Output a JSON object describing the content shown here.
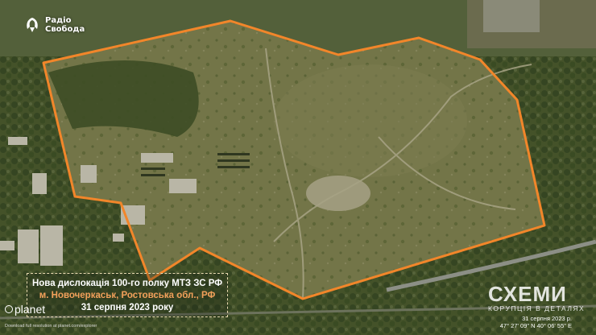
{
  "logo": {
    "line1": "Радіо",
    "line2": "Свобода",
    "icon": "radio-svoboda-icon"
  },
  "caption": {
    "title": "Нова дислокація 100-го полку МТЗ ЗС РФ",
    "location": "м. Новочеркаськ, Ростовська обл., РФ",
    "date": "31 серпня 2023 року"
  },
  "planet": {
    "label": "planet",
    "credit": "Download full resolution at planet.com/explorer"
  },
  "schemy": {
    "title": "СХЕМИ",
    "subtitle": "КОРУПЦІЯ В ДЕТАЛЯХ"
  },
  "image_meta": {
    "date": "31 серпня 2023 р.",
    "coords": "47° 27' 09\" N 40° 06' 55\" E"
  },
  "colors": {
    "outline": "#f2862a",
    "field": "#6f7447",
    "trees": "#3b4a24"
  }
}
